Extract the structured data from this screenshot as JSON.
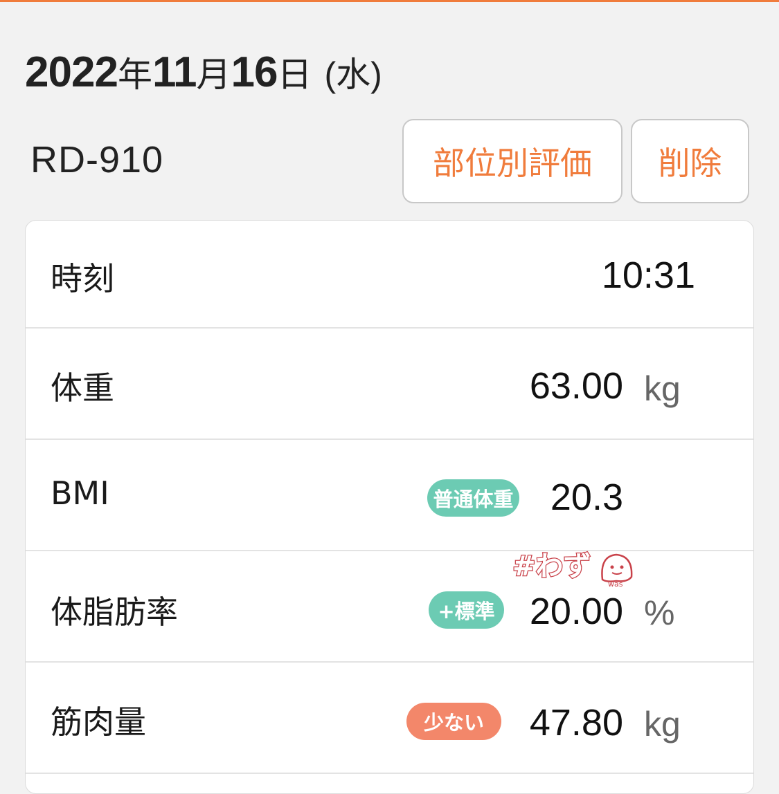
{
  "header": {
    "year": "2022",
    "year_unit": "年",
    "month": "11",
    "month_unit": "月",
    "day": "16",
    "day_unit": "日",
    "weekday": "(水)"
  },
  "device": {
    "name": "RD-910"
  },
  "actions": {
    "body_part_eval_label": "部位別評価",
    "delete_label": "削除"
  },
  "measurements": {
    "time": {
      "label": "時刻",
      "value": "10:31"
    },
    "weight": {
      "label": "体重",
      "value": "63.00",
      "unit": "kg"
    },
    "bmi": {
      "label": "BMI",
      "badge": "普通体重",
      "value": "20.3"
    },
    "body_fat": {
      "label": "体脂肪率",
      "badge": "+標準",
      "value": "20.00",
      "unit": "%"
    },
    "muscle": {
      "label": "筋肉量",
      "badge": "少ない",
      "value": "47.80",
      "unit": "kg"
    }
  },
  "watermark": {
    "text": "#わず",
    "sub": "was"
  },
  "colors": {
    "accent": "#f07c3c",
    "badge_normal": "#6ccbb3",
    "badge_low": "#f3876a",
    "background": "#f2f2f2"
  }
}
